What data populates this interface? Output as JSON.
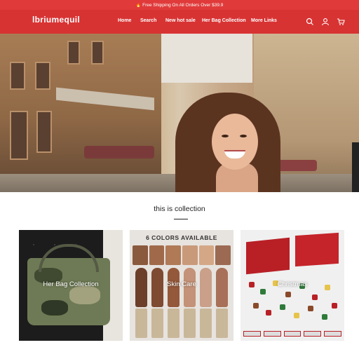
{
  "announcement": {
    "icon": "fire-icon",
    "text": "Free Shipping On All Orders Over $39.9"
  },
  "header": {
    "logo": "lbriumequil",
    "nav": [
      "Home",
      "Search",
      "New hot sale",
      "Her Bag Collection",
      "More Links"
    ],
    "icons": [
      "search-icon",
      "account-icon",
      "cart-icon"
    ],
    "bg_color": "#d83333"
  },
  "collection": {
    "title": "this is collection",
    "cards": [
      {
        "label": "Her Bag Collection"
      },
      {
        "label": "Skin Care",
        "banner": "6 COLORS AVAILABLE"
      },
      {
        "label": "Christmas"
      }
    ]
  }
}
